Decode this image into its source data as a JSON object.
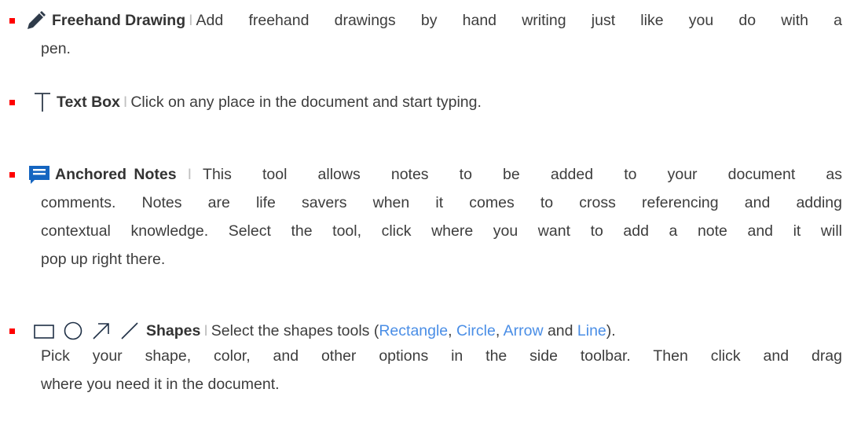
{
  "items": [
    {
      "term": "Freehand Drawing",
      "separator": "I",
      "line1": "Add freehand drawings by hand writing just like you do with a",
      "line2": "pen."
    },
    {
      "term": "Text Box",
      "separator": "I",
      "line1": "Click on any place in the document and start typing."
    },
    {
      "term": "Anchored Notes",
      "separator": "I",
      "line1": "This tool allows notes to be added to your document as",
      "line2": "comments. Notes are life savers when it comes to cross referencing and adding",
      "line3": "contextual knowledge. Select the tool, click where you want to add a note and it will",
      "line4": "pop up right there."
    },
    {
      "term": "Shapes",
      "separator": "I",
      "line1_pre": "Select the shapes tools (",
      "rectangle": "Rectangle",
      "comma1": ", ",
      "circle": "Circle",
      "comma2": ", ",
      "arrow": "Arrow",
      "and": " and ",
      "line": "Line",
      "line1_post": ").",
      "line2": "Pick your shape, color, and other options in the side toolbar. Then click and drag",
      "line3": "where you need it in the document."
    }
  ],
  "colors": {
    "bullet": "#ff0000",
    "note_icon": "#1565c0",
    "link": "#4a8ee6",
    "shape_icons": "#1e2f45"
  },
  "icons": [
    "pen-icon",
    "text-t-icon",
    "note-icon",
    "rectangle-icon",
    "circle-icon",
    "arrow-icon",
    "line-icon"
  ]
}
